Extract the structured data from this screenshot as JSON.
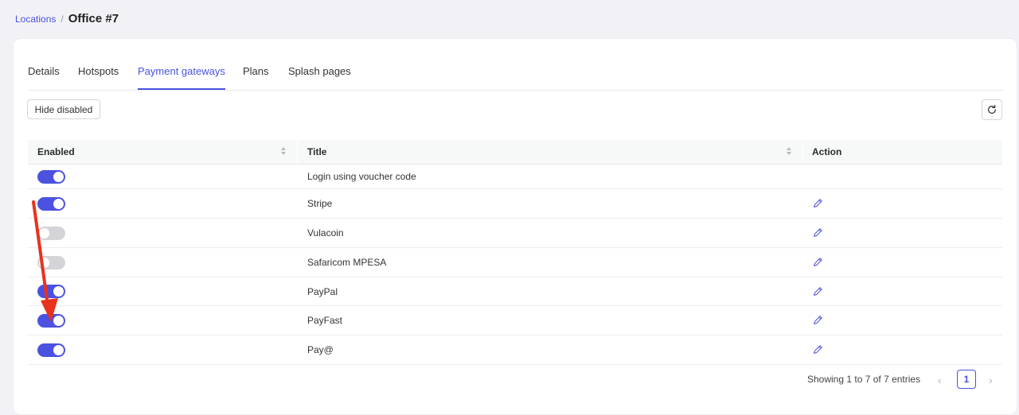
{
  "breadcrumb": {
    "parent": "Locations",
    "separator": "/",
    "current": "Office #7"
  },
  "tabs": [
    {
      "label": "Details"
    },
    {
      "label": "Hotspots"
    },
    {
      "label": "Payment gateways",
      "active": true
    },
    {
      "label": "Plans"
    },
    {
      "label": "Splash pages"
    }
  ],
  "toolbar": {
    "hide_disabled": "Hide disabled"
  },
  "table": {
    "headers": {
      "enabled": "Enabled",
      "title": "Title",
      "action": "Action"
    },
    "rows": [
      {
        "enabled": true,
        "title": "Login using voucher code",
        "editable": false
      },
      {
        "enabled": true,
        "title": "Stripe",
        "editable": true
      },
      {
        "enabled": false,
        "title": "Vulacoin",
        "editable": true
      },
      {
        "enabled": false,
        "title": "Safaricom MPESA",
        "editable": true
      },
      {
        "enabled": true,
        "title": "PayPal",
        "editable": true
      },
      {
        "enabled": true,
        "title": "PayFast",
        "editable": true
      },
      {
        "enabled": true,
        "title": "Pay@",
        "editable": true
      }
    ]
  },
  "pagination": {
    "info": "Showing 1 to 7 of 7 entries",
    "prev": "‹",
    "current_page": "1",
    "next": "›"
  },
  "colors": {
    "accent": "#4b52e0",
    "annotation_arrow": "#e8321e",
    "toggle_off": "#d4d4d8"
  }
}
